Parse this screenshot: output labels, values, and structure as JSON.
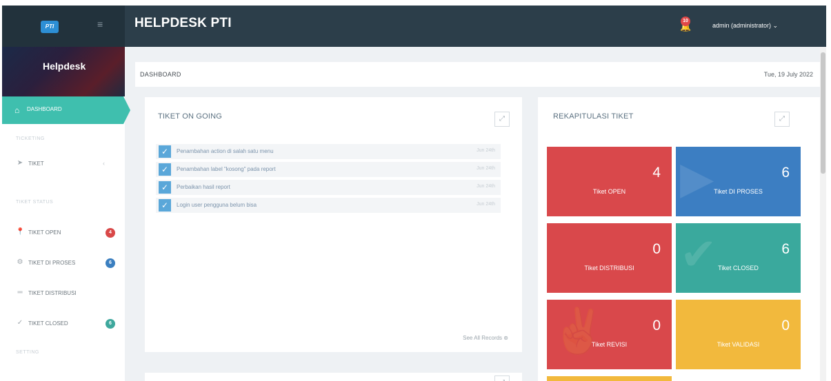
{
  "topbar": {
    "logo_text": "PTI",
    "menu_icon": "hamburger-icon",
    "title": "HELPDESK PTI",
    "notification_count": "10",
    "user": "admin (administrator)",
    "user_chevron": "⌄"
  },
  "sidebar": {
    "banner_title": "Helpdesk",
    "active_item": {
      "label": "DASHBOARD",
      "icon": "home-icon"
    },
    "sections": [
      {
        "label": "TICKETING"
      },
      {
        "label": "TIKET STATUS"
      },
      {
        "label": "SETTING"
      }
    ],
    "items": [
      {
        "label": "TIKET",
        "icon": "send-icon",
        "chevron": "‹"
      },
      {
        "label": "TIKET OPEN",
        "icon": "pin-icon",
        "badge": "4"
      },
      {
        "label": "TIKET DI PROSES",
        "icon": "gear-icon",
        "badge": "6"
      },
      {
        "label": "TIKET DISTRIBUSI",
        "icon": "lines-icon"
      },
      {
        "label": "TIKET CLOSED",
        "icon": "check-icon",
        "badge": "6"
      }
    ]
  },
  "breadcrumb": {
    "title": "DASHBOARD",
    "date": "Tue, 19 July 2022"
  },
  "ongoing": {
    "title": "TIKET ON GOING",
    "tasks": [
      {
        "text": "Penambahan action di salah satu menu",
        "date": "Jun 24th"
      },
      {
        "text": "Penambahan label \"kosong\" pada report",
        "date": "Jun 24th"
      },
      {
        "text": "Perbaikan hasil report",
        "date": "Jun 24th"
      },
      {
        "text": "Login user pengguna belum bisa",
        "date": "Jun 24th"
      }
    ],
    "see_all": "See All Records"
  },
  "rekap": {
    "title": "REKAPITULASI TIKET",
    "tiles": [
      {
        "value": "4",
        "label": "Tiket OPEN",
        "color": "#d9484b"
      },
      {
        "value": "6",
        "label": "Tiket DI PROSES",
        "color": "#3c7ec2"
      },
      {
        "value": "0",
        "label": "Tiket DISTRIBUSI",
        "color": "#d9484b"
      },
      {
        "value": "6",
        "label": "Tiket CLOSED",
        "color": "#3aa99d"
      },
      {
        "value": "0",
        "label": "Tiket REVISI",
        "color": "#d9484b"
      },
      {
        "value": "0",
        "label": "Tiket VALIDASI",
        "color": "#f2b93d"
      }
    ]
  }
}
